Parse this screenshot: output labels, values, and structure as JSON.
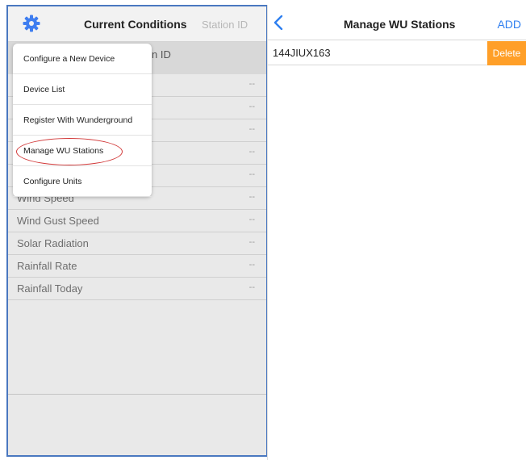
{
  "left": {
    "title": "Current Conditions",
    "tab_station": "Station ID",
    "subheader_label": "n ID",
    "gear_color": "#3f7ef0",
    "rows": [
      {
        "label": "",
        "value": "--"
      },
      {
        "label": "",
        "value": "--"
      },
      {
        "label": "",
        "value": "--"
      },
      {
        "label": "",
        "value": "--"
      },
      {
        "label": "",
        "value": "--"
      },
      {
        "label": "Wind Speed",
        "value": "--"
      },
      {
        "label": "Wind Gust Speed",
        "value": "--"
      },
      {
        "label": "Solar Radiation",
        "value": "--"
      },
      {
        "label": "Rainfall Rate",
        "value": "--"
      },
      {
        "label": "Rainfall Today",
        "value": "--"
      }
    ],
    "menu": {
      "items": [
        "Configure a New Device",
        "Device List",
        "Register With Wunderground",
        "Manage WU Stations",
        "Configure Units"
      ],
      "highlighted": "Manage WU Stations",
      "highlight_color": "#d23a3a"
    }
  },
  "right": {
    "title": "Manage WU Stations",
    "add_label": "ADD",
    "accent_color": "#2f7ff0",
    "station": {
      "id": "144JIUX163",
      "delete_label": "Delete",
      "delete_color": "#ff9f28"
    },
    "icons": {
      "back": "chevron-left-icon",
      "settings": "gear-icon"
    }
  }
}
